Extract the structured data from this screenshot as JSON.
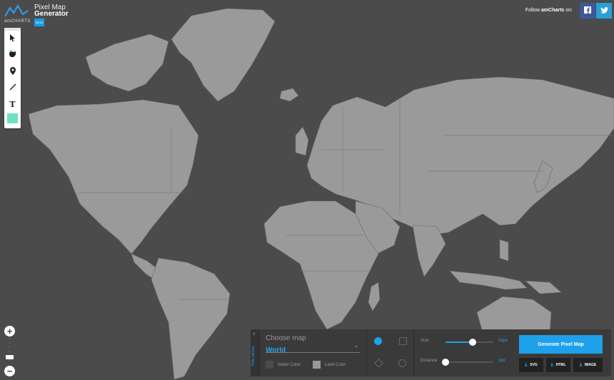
{
  "app": {
    "brand": "amCHARTS",
    "title_line1": "Pixel Map",
    "title_line2": "Generator",
    "beta": "BETA"
  },
  "header": {
    "follow_prefix": "Follow ",
    "follow_brand": "amCharts",
    "follow_suffix": " on:",
    "social": [
      "facebook-icon",
      "twitter-icon"
    ]
  },
  "toolbar": {
    "tools": [
      "pointer-icon",
      "land-brush-icon",
      "pin-icon",
      "line-icon",
      "text-icon"
    ],
    "text_tool_label": "T",
    "active_color": "#6fe0c4"
  },
  "zoom": {
    "in_label": "+",
    "out_label": "−"
  },
  "panel": {
    "hide_label": "Hide options",
    "choose_label": "Choose map",
    "map_value": "World",
    "water_label": "Water Color",
    "land_label": "Land Color",
    "water_color": "#4b4b4b",
    "land_color": "#999999",
    "size_label": "Size",
    "size_value": "16px",
    "size_fraction": 0.56,
    "distance_label": "Distance",
    "distance_value": "1px",
    "distance_fraction": 0.0,
    "generate_label": "Generate Pixel Map",
    "downloads": [
      "SVG",
      "HTML",
      "IMAGE"
    ]
  },
  "colors": {
    "background": "#4b4b4b",
    "land": "#9a9a9a",
    "accent": "#1fa0ea"
  }
}
